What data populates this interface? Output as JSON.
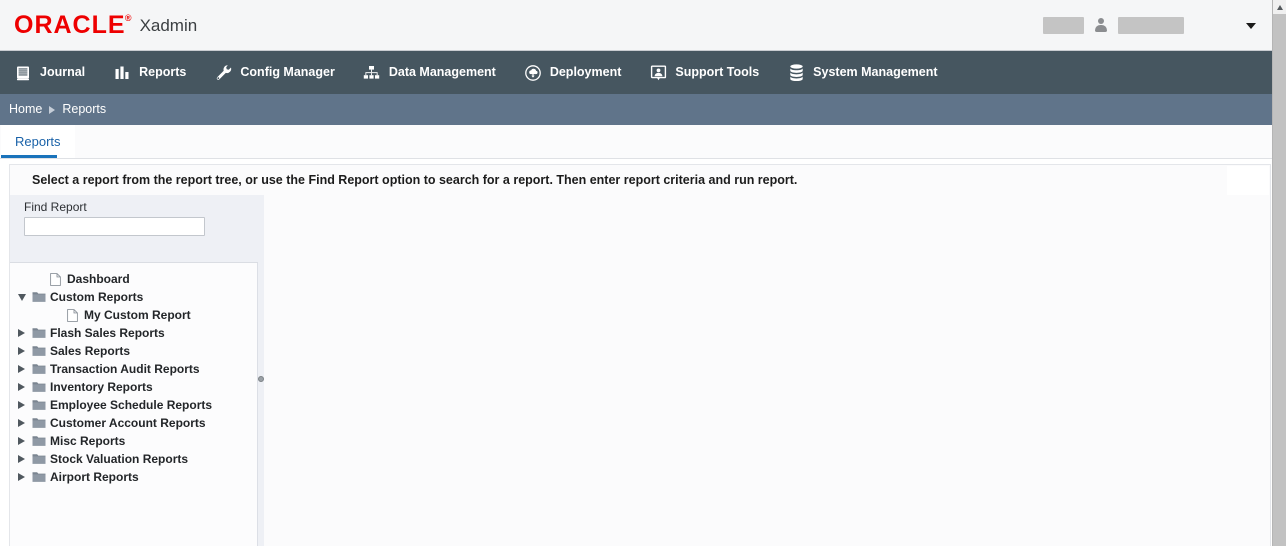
{
  "brand": {
    "logo_text": "ORACLE",
    "logo_mark": "®",
    "app_name": "Xadmin",
    "logo_color": "#ee0000"
  },
  "header": {
    "user_menu_caret": "▼",
    "redacted_field_1": "",
    "redacted_field_2": ""
  },
  "nav": {
    "items": [
      {
        "label": "Journal",
        "icon": "journal-icon"
      },
      {
        "label": "Reports",
        "icon": "bar-chart-icon"
      },
      {
        "label": "Config Manager",
        "icon": "wrench-icon"
      },
      {
        "label": "Data Management",
        "icon": "sitemap-icon"
      },
      {
        "label": "Deployment",
        "icon": "cloud-download-icon"
      },
      {
        "label": "Support Tools",
        "icon": "support-person-icon"
      },
      {
        "label": "System Management",
        "icon": "database-icon"
      }
    ],
    "background": "#465660"
  },
  "breadcrumb": {
    "items": [
      "Home",
      "Reports"
    ],
    "background": "#60748a"
  },
  "tabs": {
    "items": [
      {
        "label": "Reports",
        "active": true
      }
    ],
    "active_color": "#1a73bb"
  },
  "instruction": {
    "text": "Select a report from the report tree, or use the Find Report option to search for a report. Then enter report criteria and run report."
  },
  "find_report": {
    "label": "Find Report",
    "value": "",
    "placeholder": ""
  },
  "tree": {
    "nodes": [
      {
        "label": "Dashboard",
        "type": "leaf",
        "state": "none",
        "depth": 1
      },
      {
        "label": "Custom Reports",
        "type": "folder",
        "state": "open",
        "depth": 0
      },
      {
        "label": "My Custom Report",
        "type": "leaf",
        "state": "none",
        "depth": 2
      },
      {
        "label": "Flash Sales Reports",
        "type": "folder",
        "state": "closed",
        "depth": 0
      },
      {
        "label": "Sales Reports",
        "type": "folder",
        "state": "closed",
        "depth": 0
      },
      {
        "label": "Transaction Audit Reports",
        "type": "folder",
        "state": "closed",
        "depth": 0
      },
      {
        "label": "Inventory Reports",
        "type": "folder",
        "state": "closed",
        "depth": 0
      },
      {
        "label": "Employee Schedule Reports",
        "type": "folder",
        "state": "closed",
        "depth": 0
      },
      {
        "label": "Customer Account Reports",
        "type": "folder",
        "state": "closed",
        "depth": 0
      },
      {
        "label": "Misc Reports",
        "type": "folder",
        "state": "closed",
        "depth": 0
      },
      {
        "label": "Stock Valuation Reports",
        "type": "folder",
        "state": "closed",
        "depth": 0
      },
      {
        "label": "Airport Reports",
        "type": "folder",
        "state": "closed",
        "depth": 0
      }
    ]
  }
}
